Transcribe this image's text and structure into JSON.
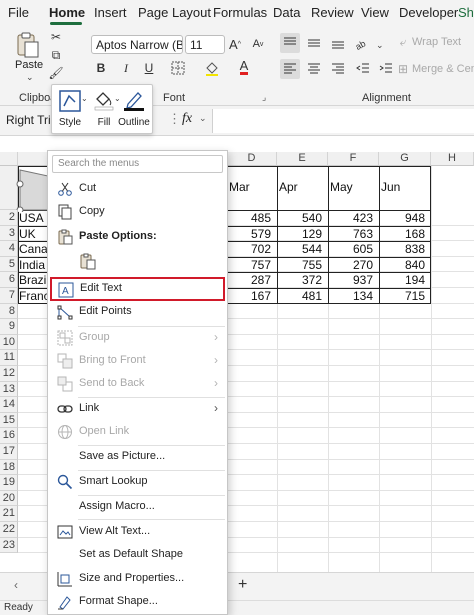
{
  "menu": {
    "tabs": [
      "File",
      "Home",
      "Insert",
      "Page Layout",
      "Formulas",
      "Data",
      "Review",
      "View",
      "Developer",
      "Sh"
    ]
  },
  "ribbon": {
    "paste_label": "Paste",
    "clipboard_label": "Clipboa",
    "font_name": "Aptos Narrow (Bod",
    "font_size": "11",
    "font_label": "Font",
    "wrap_text": "Wrap Text",
    "merge_center": "Merge & Cente",
    "alignment_label": "Alignment"
  },
  "formula_bar": {
    "name_box": "Right Tria",
    "fx": "fx"
  },
  "mini_toolbar": {
    "style": "Style",
    "fill": "Fill",
    "outline": "Outline"
  },
  "grid": {
    "columns": [
      "D",
      "E",
      "F",
      "G",
      "H"
    ],
    "rows": [
      "2",
      "3",
      "4",
      "5",
      "6",
      "7",
      "8",
      "9",
      "10",
      "11",
      "12",
      "13",
      "14",
      "15",
      "16",
      "17",
      "18",
      "19",
      "20",
      "21",
      "22",
      "23"
    ],
    "month_headers": [
      "Mar",
      "Apr",
      "May",
      "Jun"
    ],
    "countries": [
      "USA",
      "UK",
      "Canad",
      "India",
      "Brazil",
      "Franc"
    ],
    "values": [
      [
        "485",
        "540",
        "423",
        "948"
      ],
      [
        "579",
        "129",
        "763",
        "168"
      ],
      [
        "702",
        "544",
        "605",
        "838"
      ],
      [
        "757",
        "755",
        "270",
        "840"
      ],
      [
        "287",
        "372",
        "937",
        "194"
      ],
      [
        "167",
        "481",
        "134",
        "715"
      ]
    ]
  },
  "context_menu": {
    "search_placeholder": "Search the menus",
    "cut": "Cut",
    "copy": "Copy",
    "paste_options": "Paste Options:",
    "edit_text": "Edit Text",
    "edit_points": "Edit Points",
    "group": "Group",
    "bring_to_front": "Bring to Front",
    "send_to_back": "Send to Back",
    "link": "Link",
    "open_link": "Open Link",
    "save_as_picture": "Save as Picture...",
    "smart_lookup": "Smart Lookup",
    "assign_macro": "Assign Macro...",
    "view_alt_text": "View Alt Text...",
    "set_default_shape": "Set as Default Shape",
    "size_properties": "Size and Properties...",
    "format_shape": "Format Shape..."
  },
  "sheet": {
    "add_sheet": "+",
    "status": "Ready"
  },
  "colors": {
    "accent_green": "#1e6e3e",
    "highlight_red": "#d11a2a",
    "font_color_red": "#e02020"
  }
}
